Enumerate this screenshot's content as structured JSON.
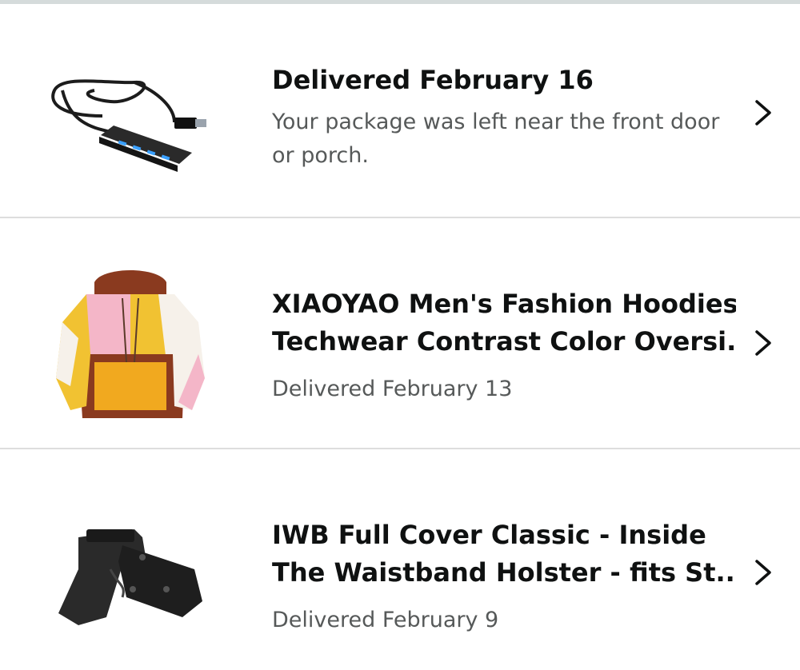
{
  "orders": [
    {
      "title": "Delivered February 16",
      "subtitle": "Your package was left near the front door or porch.",
      "thumbnail_icon": "usb-hub-product-image"
    },
    {
      "title_line1": "XIAOYAO Men's Fashion Hoodies",
      "title_line2": "Techwear Contrast Color Oversi...",
      "subtitle": "Delivered February 13",
      "thumbnail_icon": "hoodie-product-image"
    },
    {
      "title_line1": "IWB Full Cover Classic - Inside",
      "title_line2": "The Waistband Holster - fits St...",
      "subtitle": "Delivered February 9",
      "thumbnail_icon": "holster-product-image"
    }
  ],
  "colors": {
    "title": "#0f1111",
    "subtitle": "#565959",
    "divider": "#dddddd"
  }
}
